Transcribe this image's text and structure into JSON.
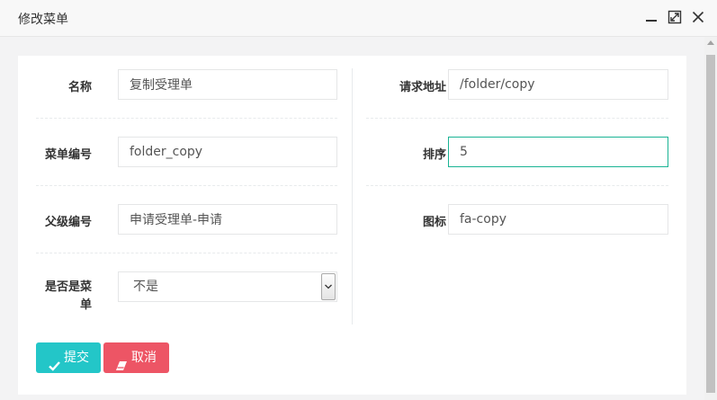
{
  "dialog": {
    "title": "修改菜单"
  },
  "form": {
    "name": {
      "label": "名称",
      "value": "复制受理单"
    },
    "url": {
      "label": "请求地址",
      "value": "/folder/copy"
    },
    "menu_code": {
      "label": "菜单编号",
      "value": "folder_copy"
    },
    "order": {
      "label": "排序",
      "value": "5"
    },
    "parent_code": {
      "label": "父级编号",
      "value": "申请受理单-申请"
    },
    "icon": {
      "label": "图标",
      "value": "fa-copy"
    },
    "is_menu": {
      "label_line1": "是否是菜",
      "label_line2": "单",
      "selected": "不是"
    }
  },
  "buttons": {
    "submit": "提交",
    "cancel": "取消"
  },
  "colors": {
    "submit_bg": "#23c6c8",
    "cancel_bg": "#ed5565",
    "focus_border": "#1ab394"
  },
  "icons": {
    "minimize": "minimize-icon",
    "maximize": "maximize-icon",
    "close": "close-icon",
    "submit": "check-icon",
    "cancel": "eraser-icon"
  }
}
